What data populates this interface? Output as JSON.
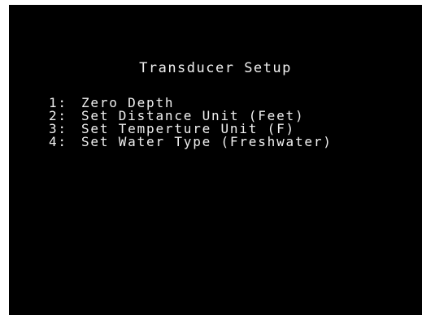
{
  "screen": {
    "title": "Transducer Setup",
    "menu_items": [
      {
        "number": "1:",
        "label": "Zero Depth"
      },
      {
        "number": "2:",
        "label": "Set Distance Unit (Feet)"
      },
      {
        "number": "3:",
        "label": "Set Temperture Unit (F)"
      },
      {
        "number": "4:",
        "label": "Set Water Type (Freshwater)"
      }
    ]
  },
  "colors": {
    "background": "#000000",
    "text": "#f0f0f0",
    "frame": "#ffffff"
  }
}
